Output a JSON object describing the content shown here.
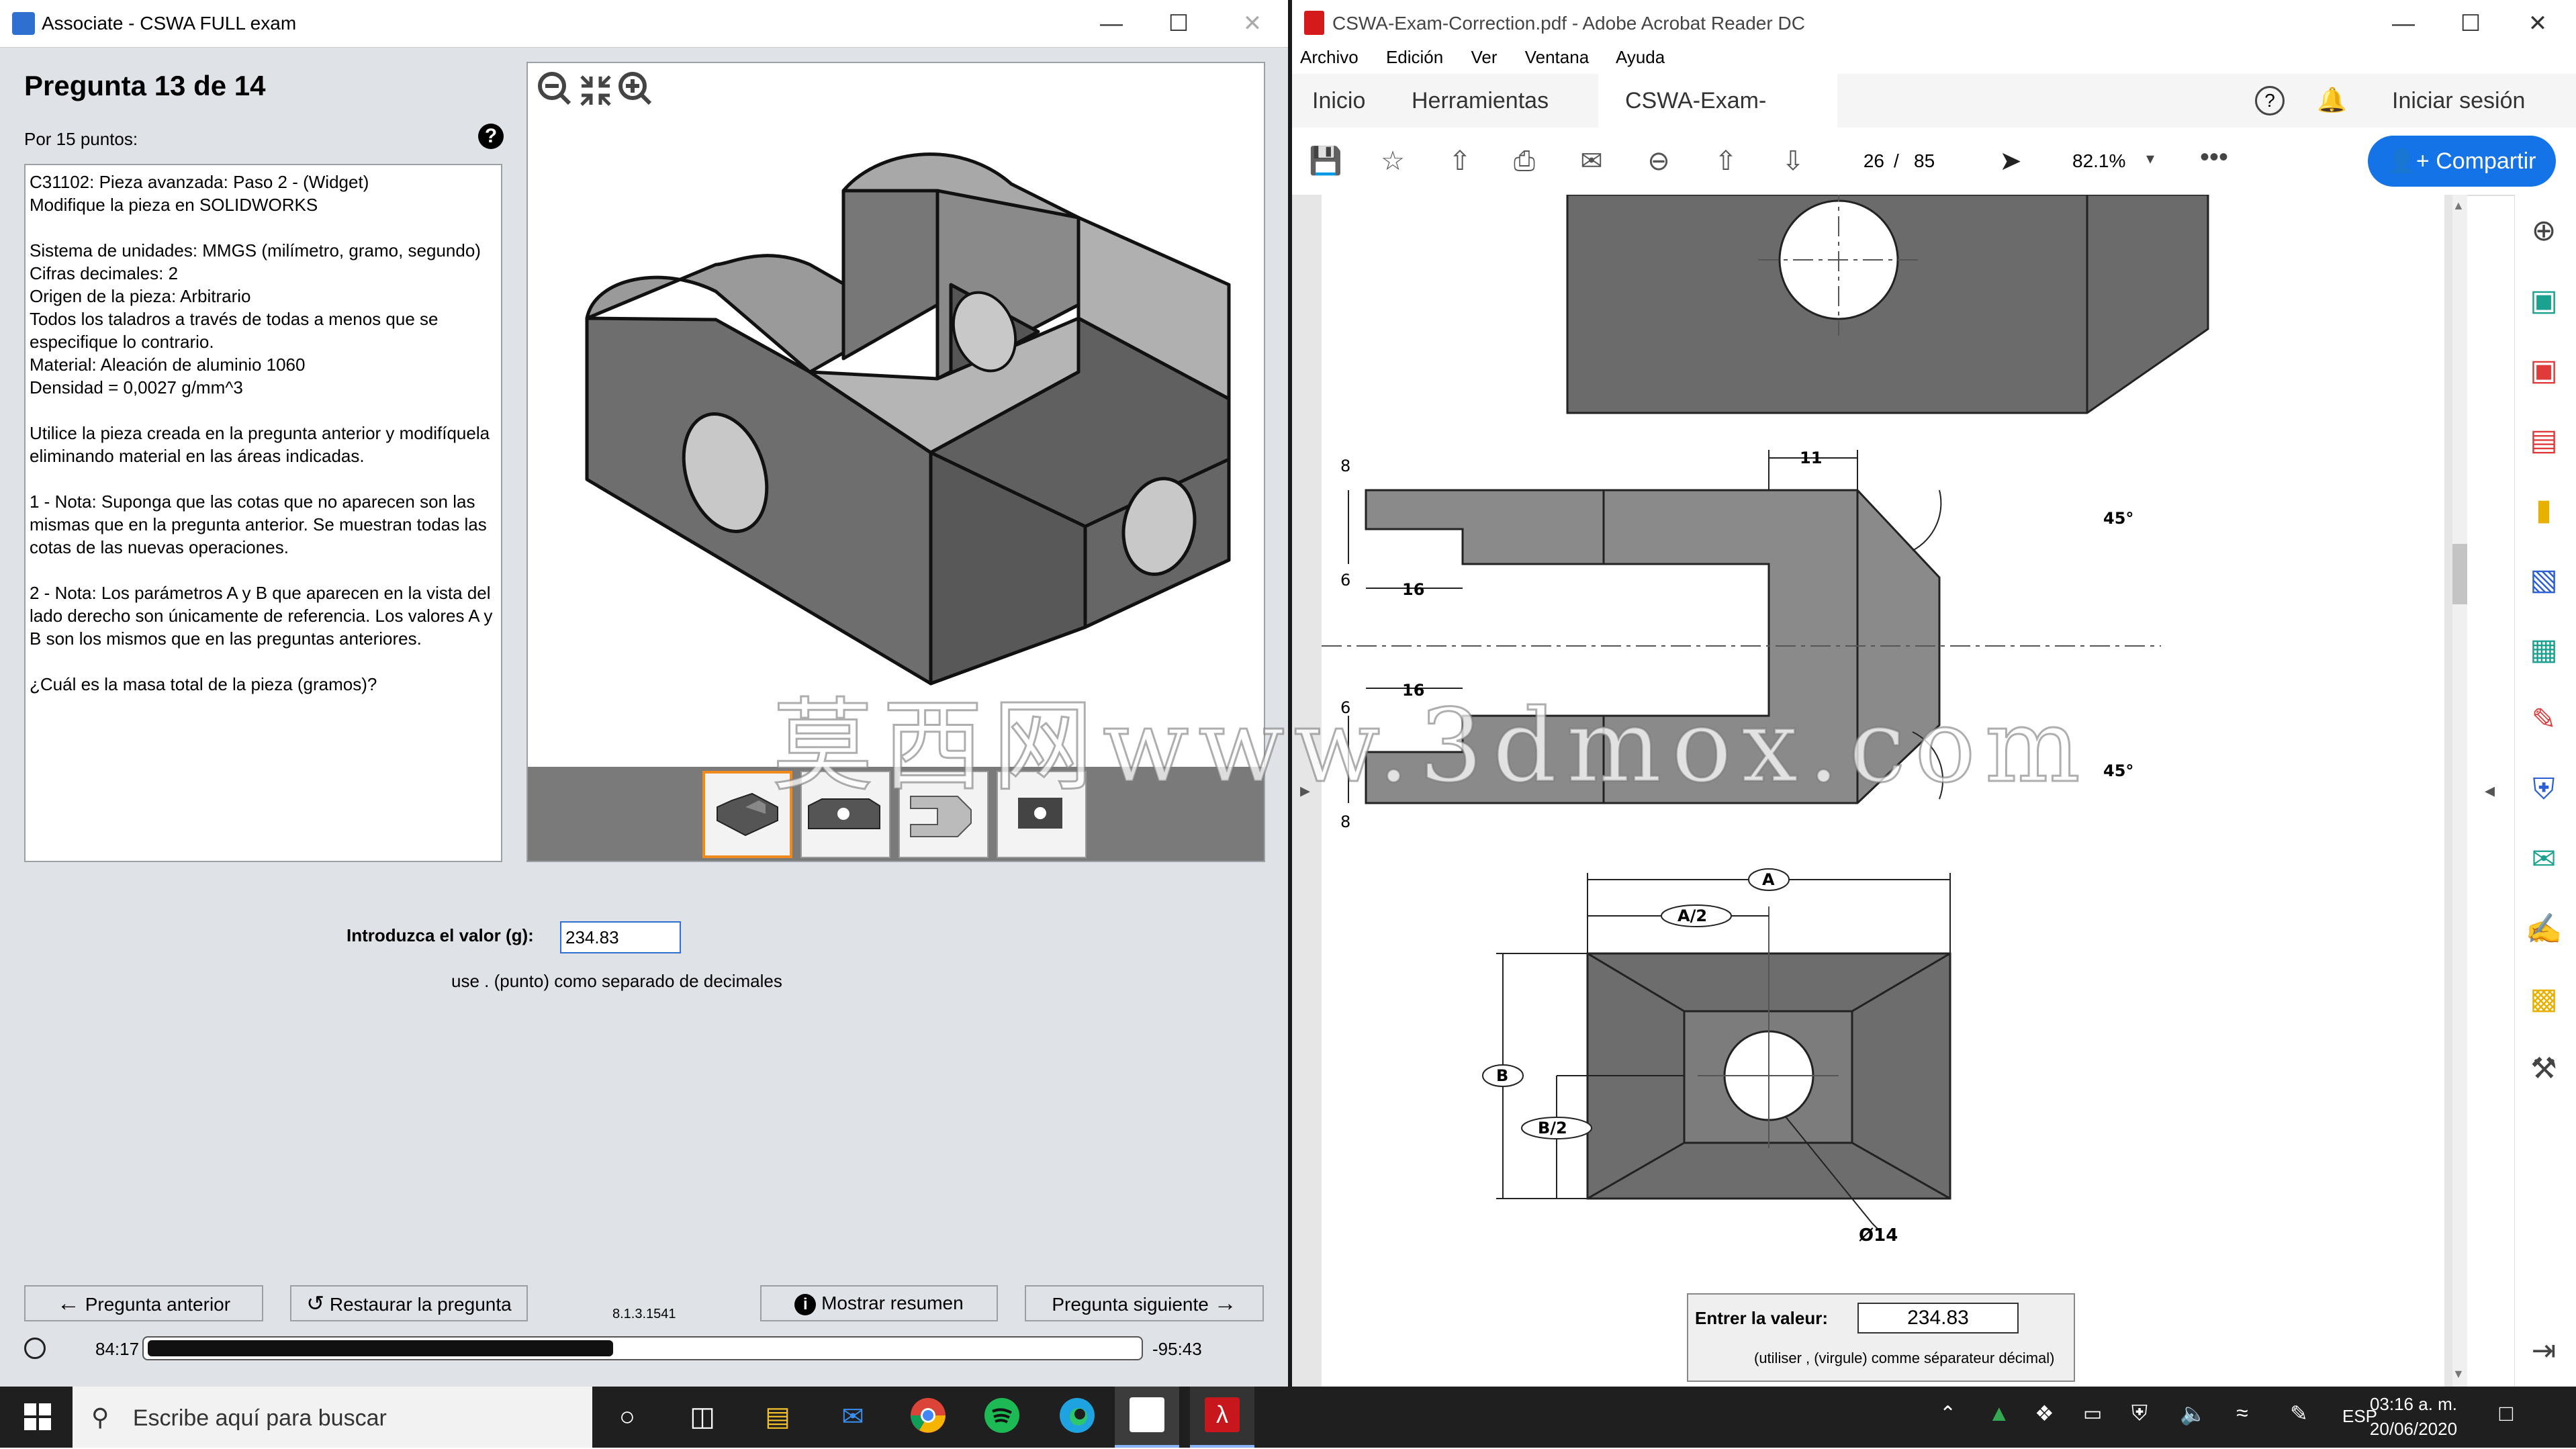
{
  "left_window": {
    "title": "Associate - CSWA FULL exam",
    "question_title": "Pregunta 13 de 14",
    "points": "Por 15 puntos:",
    "help_icon": "question-circle-icon",
    "question_paragraphs": [
      "C31102:  Pieza avanzada: Paso 2 - (Widget)\nModifique la pieza en SOLIDWORKS",
      "Sistema de unidades: MMGS (milímetro, gramo, segundo)\nCifras decimales: 2\nOrigen de la pieza: Arbitrario\nTodos los taladros a través de todas a menos que se especifique lo contrario.\nMaterial: Aleación de aluminio 1060\nDensidad = 0,0027 g/mm^3",
      "Utilice la pieza creada en la pregunta anterior y modifíquela eliminando material en las áreas indicadas.",
      "1 - Nota: Suponga que las cotas que no aparecen son las mismas que en la pregunta anterior.  Se muestran todas las cotas de las nuevas operaciones.",
      "2 - Nota: Los parámetros A y B que aparecen en la vista del lado derecho son únicamente de referencia.  Los valores A y B son los mismos que en las preguntas anteriores.",
      "¿Cuál es la masa total de la pieza (gramos)?"
    ],
    "value_label": "Introduzca el valor (g):",
    "value": "234.83",
    "decimal_hint": "use . (punto) como separado de decimales",
    "buttons": {
      "previous": "Pregunta anterior",
      "restore": "Restaurar la pregunta",
      "summary": "Mostrar resumen",
      "next": "Pregunta siguiente"
    },
    "version": "8.1.3.1541",
    "elapsed": "84:17",
    "remaining": "-95:43",
    "progress_fraction": 0.47
  },
  "right_window": {
    "title": "CSWA-Exam-Correction.pdf - Adobe Acrobat Reader DC",
    "menu": [
      "Archivo",
      "Edición",
      "Ver",
      "Ventana",
      "Ayuda"
    ],
    "tabs": [
      "Inicio",
      "Herramientas",
      "CSWA-Exam-Correc..."
    ],
    "sign_in": "Iniciar sesión",
    "page_current": "26",
    "page_sep": "/",
    "page_total": "85",
    "zoom": "82.1%",
    "share": "Compartir",
    "dims": {
      "d8a": "8",
      "d6a": "6",
      "d16a": "16",
      "d11": "11",
      "d45a": "45°",
      "d6b": "6",
      "d16b": "16",
      "d8b": "8",
      "d45b": "45°",
      "A": "A",
      "A2": "A/2",
      "B": "B",
      "B2": "B/2",
      "dia": "Ø14"
    },
    "entry_label": "Entrer la valeur:",
    "entry_value": "234.83",
    "entry_hint": "(utiliser , (virgule) comme séparateur décimal)"
  },
  "watermark": "莫西网www.3dmox.com",
  "taskbar": {
    "search_placeholder": "Escribe aquí para buscar",
    "lang": "ESP",
    "time": "03:16 a. m.",
    "date": "20/06/2020"
  }
}
